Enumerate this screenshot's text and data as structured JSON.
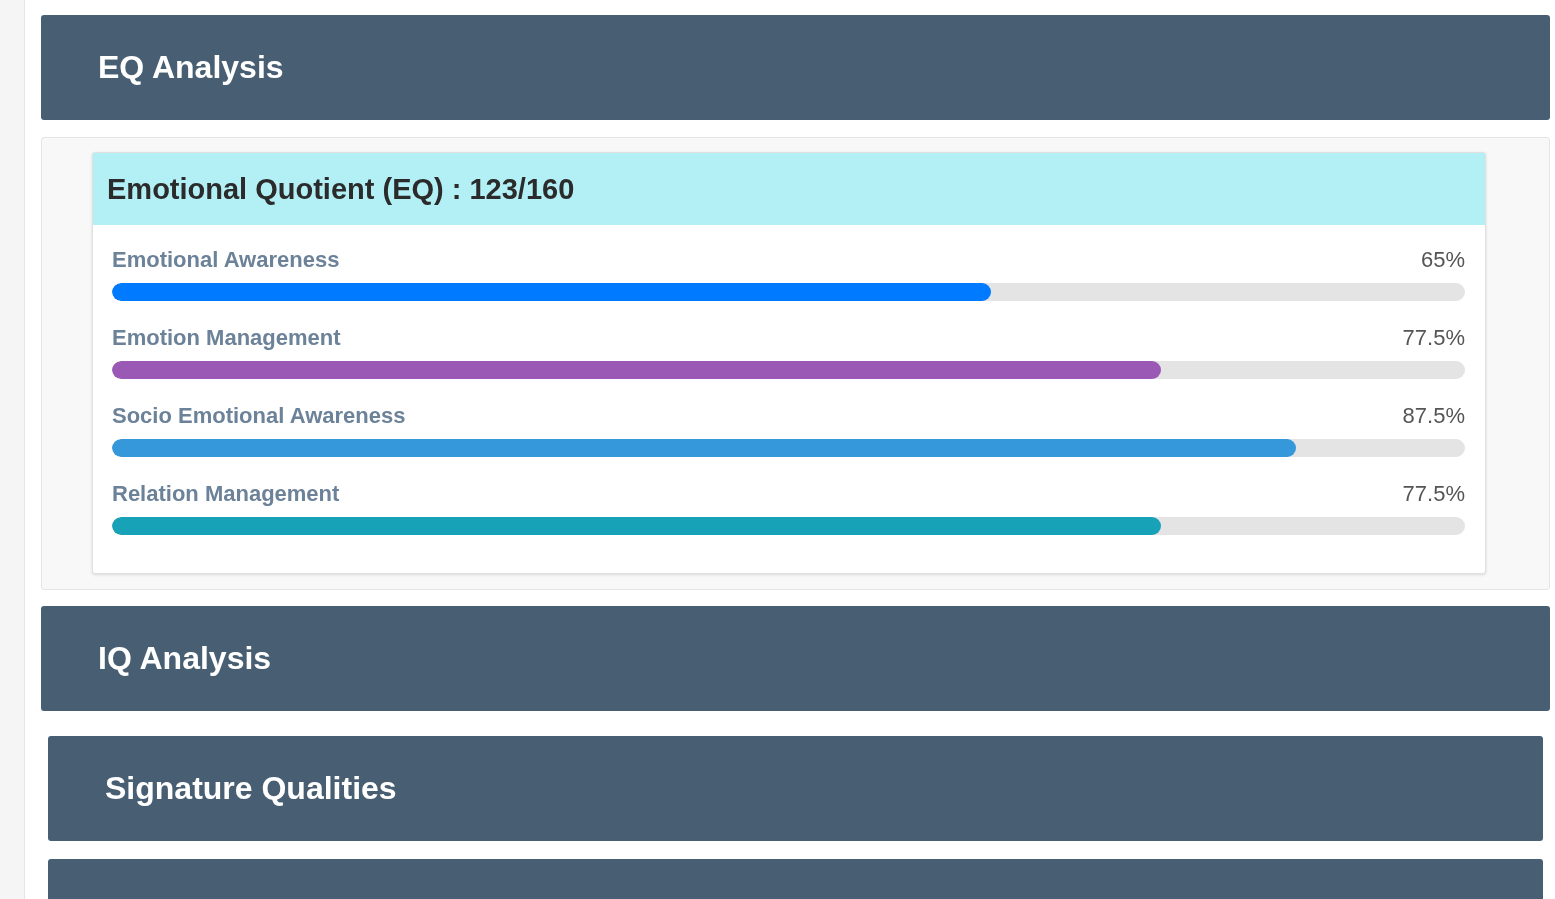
{
  "sections": [
    {
      "title": "EQ Analysis",
      "card": {
        "title": "Emotional Quotient (EQ) : 123/160",
        "metrics": [
          {
            "label": "Emotional Awareness",
            "reading": "65%",
            "level": 0.65,
            "color": "#007bff"
          },
          {
            "label": "Emotion Management",
            "reading": "77.5%",
            "level": 0.775,
            "color": "#9b59b6"
          },
          {
            "label": "Socio Emotional Awareness",
            "reading": "87.5%",
            "level": 0.875,
            "color": "#3498db"
          },
          {
            "label": "Relation Management",
            "reading": "77.5%",
            "level": 0.775,
            "color": "#17a2b8"
          }
        ]
      }
    },
    {
      "title": "IQ Analysis"
    },
    {
      "title": "Signature Qualities"
    }
  ]
}
